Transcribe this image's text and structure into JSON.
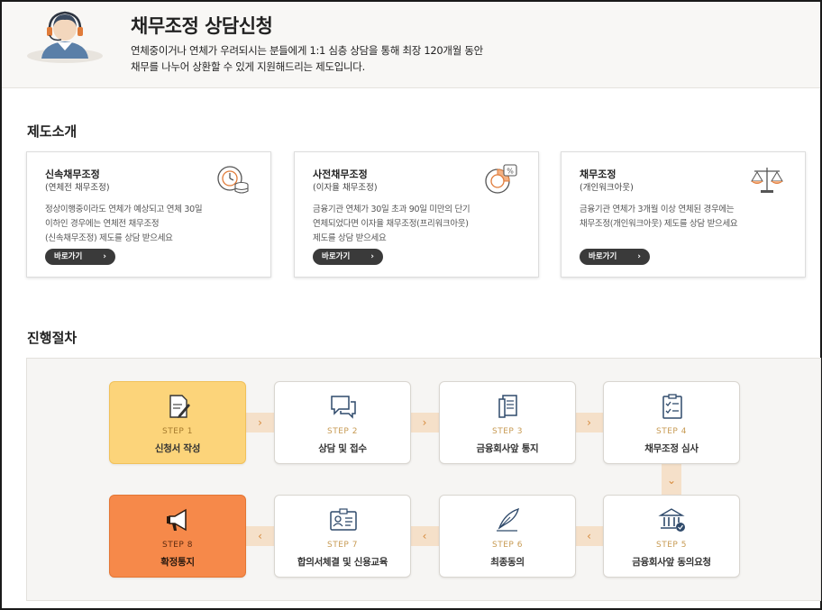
{
  "header": {
    "title": "채무조정 상담신청",
    "desc_line1": "연체중이거나 연체가 우려되시는 분들에게 1:1 심층 상담을 통해 최장 120개월 동안",
    "desc_line2": "채무를 나누어 상환할 수 있게 지원해드리는 제도입니다."
  },
  "intro": {
    "section_title": "제도소개",
    "cards": [
      {
        "title": "신속채무조정",
        "subtitle": "(연체전 채무조정)",
        "desc1": "정상이행중이라도 연체가 예상되고 연체 30일",
        "desc2": "이하인 경우에는 연체전 채무조정",
        "desc3": "(신속채무조정) 제도를 상담 받으세요",
        "button": "바로가기",
        "icon": "clock-coins-icon"
      },
      {
        "title": "사전채무조정",
        "subtitle": "(이자율 채무조정)",
        "desc1": "금융기관 연체가 30일 초과 90일 미만의 단기",
        "desc2": "연체되었다면 이자율 채무조정(프리워크아웃)",
        "desc3": "제도를 상담 받으세요",
        "button": "바로가기",
        "icon": "percent-chart-icon"
      },
      {
        "title": "채무조정",
        "subtitle": "(개인워크아웃)",
        "desc1": "금융기관 연체가 3개월 이상 연체된 경우에는",
        "desc2": "채무조정(개인워크아웃) 제도를 상담 받으세요",
        "desc3": "",
        "button": "바로가기",
        "icon": "scale-icon"
      }
    ]
  },
  "process": {
    "section_title": "진행절차",
    "steps": [
      {
        "no": "STEP 1",
        "label": "신청서 작성",
        "icon": "document-pen-icon"
      },
      {
        "no": "STEP 2",
        "label": "상담 및 접수",
        "icon": "chat-bubbles-icon"
      },
      {
        "no": "STEP 3",
        "label": "금융회사앞 통지",
        "icon": "document-stack-icon"
      },
      {
        "no": "STEP 4",
        "label": "채무조정 심사",
        "icon": "clipboard-checklist-icon"
      },
      {
        "no": "STEP 5",
        "label": "금융회사앞 동의요청",
        "icon": "bank-check-icon"
      },
      {
        "no": "STEP 6",
        "label": "최종동의",
        "icon": "quill-pen-icon"
      },
      {
        "no": "STEP 7",
        "label": "합의서체결 및 신용교육",
        "icon": "id-card-icon"
      },
      {
        "no": "STEP 8",
        "label": "확정통지",
        "icon": "megaphone-icon"
      }
    ],
    "colors": {
      "step1": "#fcd47a",
      "step8": "#f6894a",
      "connector": "#f5e0c9",
      "arrow": "#d68a3c"
    }
  }
}
